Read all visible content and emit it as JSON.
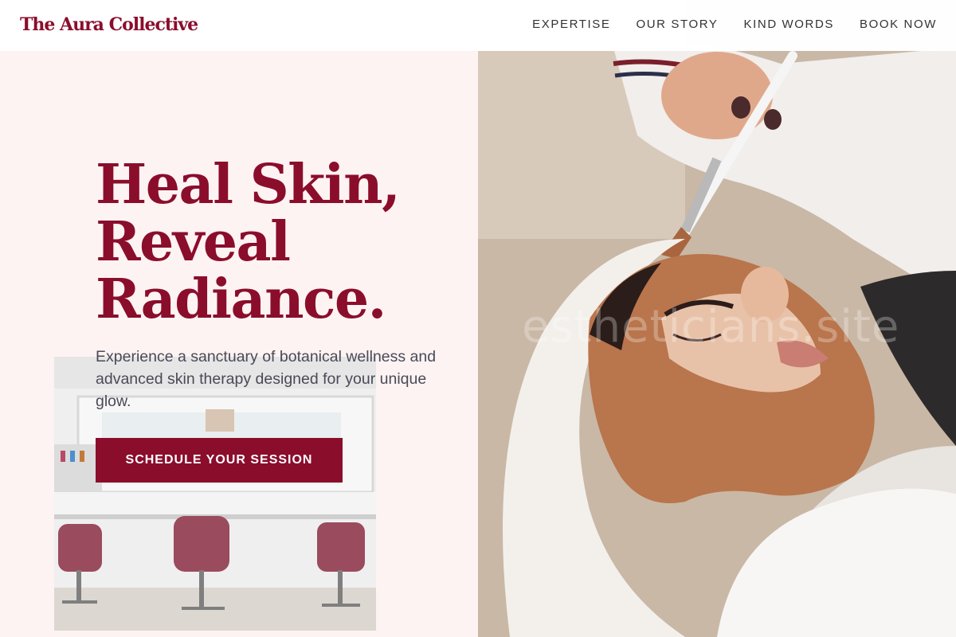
{
  "header": {
    "logo": "The Aura Collective",
    "nav": [
      "EXPERTISE",
      "OUR STORY",
      "KIND WORDS",
      "BOOK NOW"
    ]
  },
  "hero": {
    "headline_lines": [
      "Heal Skin,",
      "Reveal",
      "Radiance."
    ],
    "subtext": "Experience a sanctuary of botanical wellness and advanced skin therapy designed for your unique glow.",
    "cta_label": "SCHEDULE YOUR SESSION",
    "watermark": "estheticians.site"
  },
  "images": {
    "hero_photo": "woman receiving clay facial mask applied with brush",
    "salon_photo": "beauty salon interior with burgundy chairs and mirrors"
  },
  "colors": {
    "brand": "#8b0d2c",
    "background": "#fdf3f2",
    "nav_text": "#333333",
    "body_text": "#4a4a58"
  }
}
